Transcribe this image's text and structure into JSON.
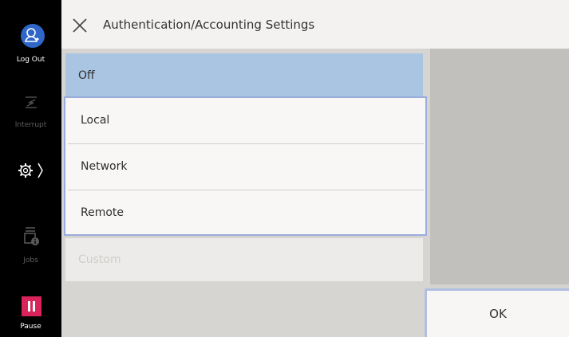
{
  "header": {
    "title": "Authentication/Accounting Settings"
  },
  "sidebar": {
    "logout_label": "Log Out",
    "interrupt_label": "Interrupt",
    "jobs_label": "Jobs",
    "pause_label": "Pause"
  },
  "options": {
    "off": "Off",
    "local": "Local",
    "network": "Network",
    "remote": "Remote",
    "custom": "Custom"
  },
  "ok_label": "OK",
  "colors": {
    "accent": "#2f66c7",
    "selected": "#a9c5e2",
    "pause": "#d8245b"
  }
}
